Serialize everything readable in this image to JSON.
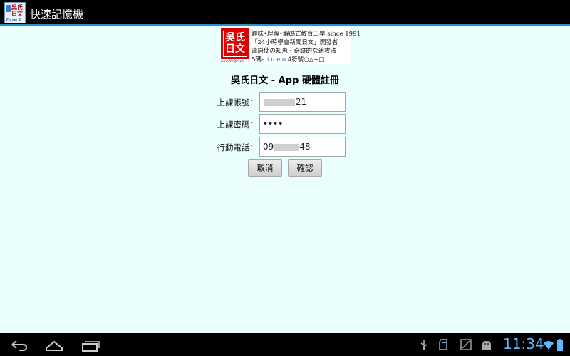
{
  "app": {
    "title": "快速記憶機",
    "icon_text_1": "吳氏",
    "icon_text_2": "日文",
    "icon_sub": "Player 2",
    "icon_name": "app-icon"
  },
  "banner": {
    "logo_line1": "吳氏",
    "logo_line2": "日文",
    "logo_url": "www.WUSJP.com",
    "line1": "趣味•理解•解碼式教育工學 since 1991",
    "line2": "「24小時學會新聞日文」開發者",
    "line3": "遣唐使の知恵・奇跡的な速攻法",
    "line4_prefix": "5碼",
    "line4_kana": "a i u e o",
    "line4_suffix": "4符號○△+□"
  },
  "heading": "吳氏日文 - App 硬體註冊",
  "form": {
    "account_label": "上課帳號：",
    "account_value_suffix": "21",
    "password_label": "上課密碼：",
    "password_value": "••••",
    "phone_label": "行動電話：",
    "phone_value_prefix": "09",
    "phone_value_suffix": "48"
  },
  "buttons": {
    "cancel": "取消",
    "confirm": "確認"
  },
  "statusbar": {
    "time": "11:34"
  },
  "colors": {
    "background": "#eafefe",
    "clock": "#5fb8ff",
    "logo_red": "#dd0000",
    "accent_line": "#2b8fc7"
  },
  "icons": [
    "back-icon",
    "home-icon",
    "recent-apps-icon",
    "usb-icon",
    "sd-card-icon",
    "screenshot-icon",
    "android-debug-icon",
    "wifi-icon",
    "battery-icon"
  ]
}
